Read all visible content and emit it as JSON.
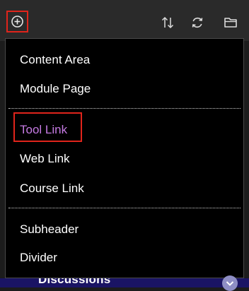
{
  "toolbar": {
    "icons": [
      "add-circle-icon",
      "sort-arrows-icon",
      "refresh-icon",
      "folder-icon"
    ]
  },
  "menu": {
    "group1": [
      "Content Area",
      "Module Page"
    ],
    "group2": [
      "Tool Link",
      "Web Link",
      "Course Link"
    ],
    "group3": [
      "Subheader",
      "Divider"
    ]
  },
  "background": {
    "partial_label": "Discussions"
  },
  "colors": {
    "highlight_text": "#c67be3",
    "highlight_box": "#e0241b",
    "menu_bg": "#000000",
    "toolbar_bg": "#2a2a2a",
    "nav_bg": "#1a1464"
  }
}
